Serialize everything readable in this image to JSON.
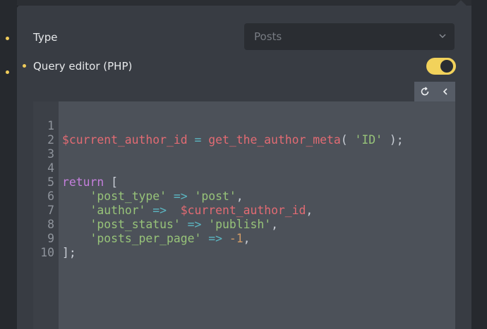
{
  "type_field": {
    "label": "Type",
    "selected": "Posts"
  },
  "query_editor": {
    "label": "Query editor (PHP)",
    "enabled": true
  },
  "toolbar": {
    "refresh_icon": "refresh-icon",
    "collapse_icon": "chevron-left-icon"
  },
  "colors": {
    "accent": "#f2d25b",
    "panel": "#383c43",
    "editor_bg": "#4c5159",
    "gutter_bg": "#3c4047"
  },
  "code": {
    "line_numbers": [
      "1",
      "2",
      "3",
      "4",
      "5",
      "6",
      "7",
      "8",
      "9",
      "10"
    ],
    "l1": [
      "$current_author_id",
      " = ",
      "get_the_author_meta",
      "( ",
      "'ID'",
      " );"
    ],
    "l4": [
      "return",
      " ["
    ],
    "l5": [
      "    ",
      "'post_type'",
      " => ",
      "'post'",
      ","
    ],
    "l6": [
      "    ",
      "'author'",
      " =>  ",
      "$current_author_id",
      ","
    ],
    "l7": [
      "    ",
      "'post_status'",
      " => ",
      "'publish'",
      ","
    ],
    "l8": [
      "    ",
      "'posts_per_page'",
      " => ",
      "-1",
      ","
    ],
    "l9": [
      "];"
    ]
  }
}
